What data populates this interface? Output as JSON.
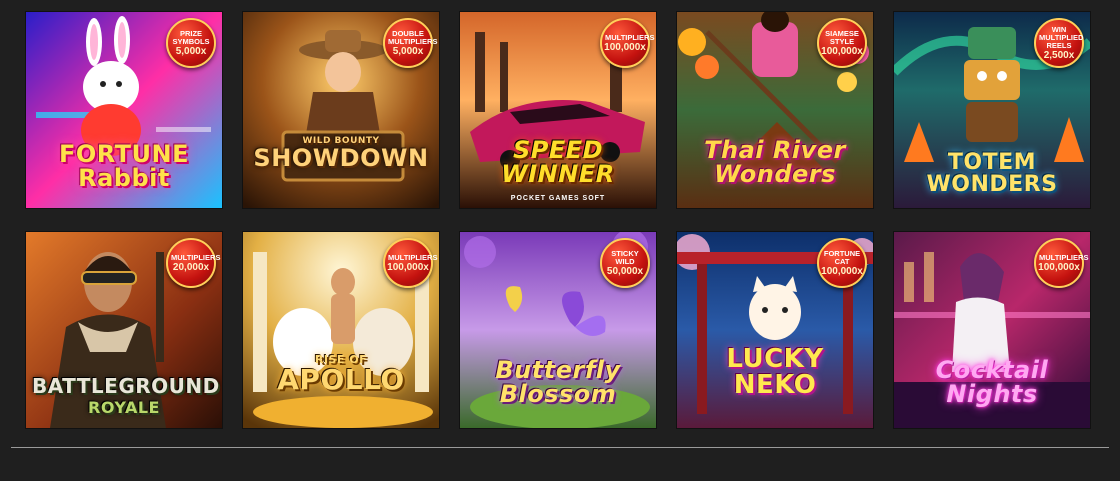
{
  "games": [
    {
      "title": "FORTUNE Rabbit",
      "badge_text": "PRIZE SYMBOLS",
      "badge_value": "5,000x",
      "colors": [
        "#1a2bd6",
        "#ff2ea6",
        "#19e3ff"
      ]
    },
    {
      "title": "SHOWDOWN",
      "title_top": "WILD BOUNTY",
      "badge_text": "DOUBLE MULTIPLIERS",
      "badge_value": "5,000x",
      "colors": [
        "#3a1d08",
        "#b3671e",
        "#ffcd6b"
      ]
    },
    {
      "title": "SPEED WINNER",
      "subtitle": "POCKET GAMES SOFT",
      "badge_text": "MULTIPLIERS",
      "badge_value": "100,000x",
      "colors": [
        "#2a1006",
        "#d4662a",
        "#ffb061"
      ]
    },
    {
      "title": "Thai River Wonders",
      "badge_text": "SIAMESE STYLE",
      "badge_value": "100,000x",
      "colors": [
        "#5a2e12",
        "#e85b9a",
        "#ffd06a"
      ]
    },
    {
      "title": "TOTEM WONDERS",
      "badge_text": "WIN MULTIPLIED REELS",
      "badge_value": "2,500x",
      "colors": [
        "#0d2a4a",
        "#33c8a6",
        "#ff7a1f"
      ]
    },
    {
      "title": "BATTLEGROUND",
      "title2": "ROYALE",
      "badge_text": "MULTIPLIERS",
      "badge_value": "20,000x",
      "colors": [
        "#3a1a0c",
        "#c9541f",
        "#f3b25b"
      ]
    },
    {
      "title": "APOLLO",
      "title_top": "RISE OF",
      "badge_text": "MULTIPLIERS",
      "badge_value": "100,000x",
      "colors": [
        "#5a3509",
        "#e3b045",
        "#fff0c2"
      ]
    },
    {
      "title": "Butterfly Blossom",
      "badge_text": "STICKY WILD",
      "badge_value": "50,000x",
      "colors": [
        "#3a1a5a",
        "#b06ee8",
        "#f8e06a"
      ]
    },
    {
      "title": "LUCKY NEKO",
      "badge_text": "FORTUNE CAT",
      "badge_value": "100,000x",
      "colors": [
        "#0d2f6a",
        "#cc2d6d",
        "#ffb3d6"
      ]
    },
    {
      "title": "Cocktail Nights",
      "badge_text": "MULTIPLIERS",
      "badge_value": "100,000x",
      "colors": [
        "#2a0b36",
        "#b8276a",
        "#ffb0d0"
      ]
    }
  ]
}
